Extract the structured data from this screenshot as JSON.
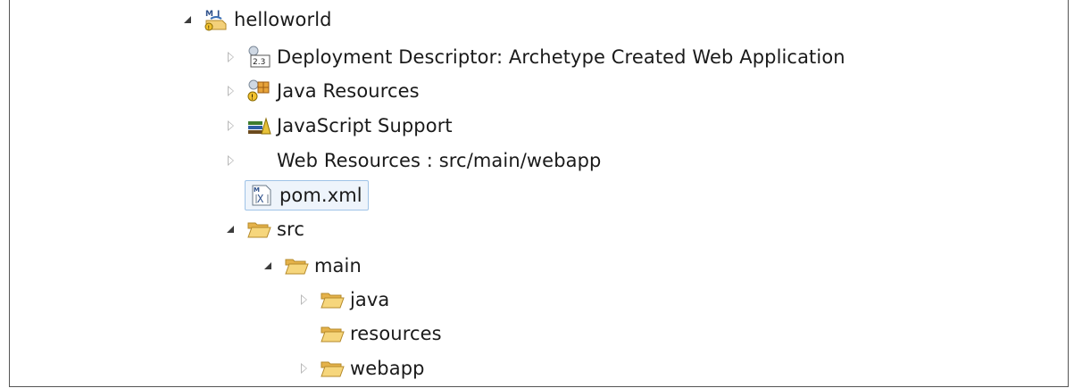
{
  "tree": {
    "project": {
      "label": "helloworld"
    },
    "items": [
      {
        "label": "Deployment Descriptor: Archetype Created Web Application"
      },
      {
        "label": "Java Resources"
      },
      {
        "label": "JavaScript Support"
      },
      {
        "label": "Web Resources : src/main/webapp"
      },
      {
        "label": "pom.xml"
      },
      {
        "label": "src"
      },
      {
        "label": "main"
      },
      {
        "label": "java"
      },
      {
        "label": "resources"
      },
      {
        "label": "webapp"
      }
    ]
  },
  "icons": {
    "project": "maven-web-project-icon",
    "descriptor": "deployment-descriptor-icon",
    "java_resources": "java-resources-icon",
    "js_support": "javascript-library-icon",
    "pom": "xml-file-icon",
    "folder": "folder-open-icon"
  },
  "colors": {
    "selection_bg": "#eef4fb",
    "selection_border": "#9fc3e7",
    "folder": "#f2c866"
  }
}
